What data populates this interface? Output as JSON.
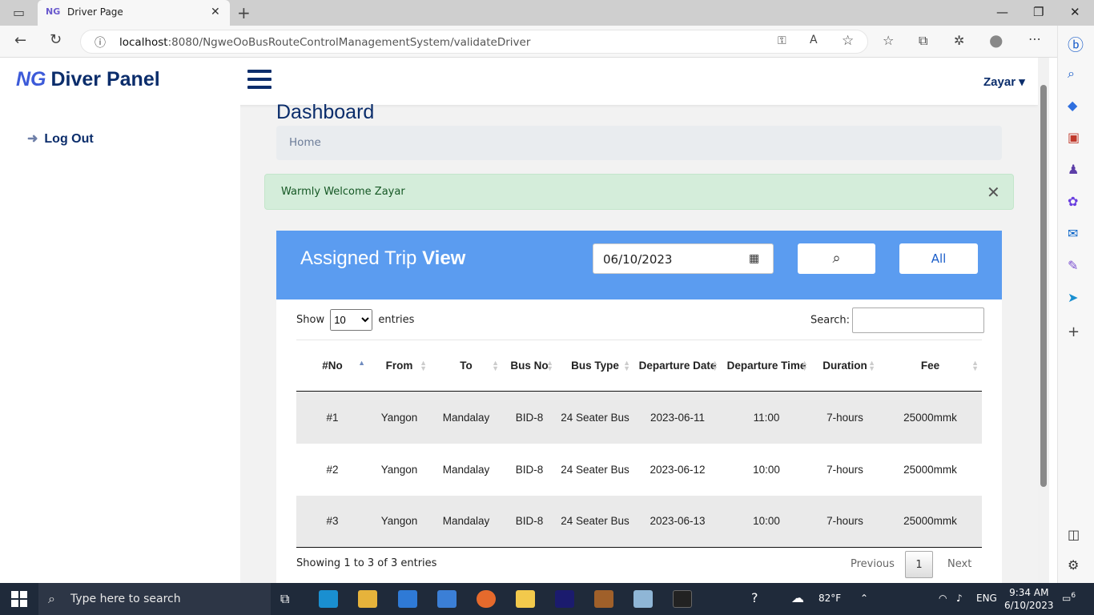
{
  "browser": {
    "tab_title": "Driver Page",
    "url_host": "localhost",
    "url_rest": ":8080/NgweOoBusRouteControlManagementSystem/validateDriver",
    "controls": {
      "minimize": "—",
      "restore": "❐",
      "close": "✕"
    }
  },
  "header": {
    "logo": "NG",
    "brand": "Diver Panel",
    "user": "Zayar ▾"
  },
  "sidebar": {
    "items": [
      {
        "label": "Log Out",
        "icon": "arrow-right-icon"
      }
    ]
  },
  "main": {
    "title": "Dashboard",
    "breadcrumb": "Home",
    "alert": "Warmly Welcome Zayar"
  },
  "card": {
    "title_light": "Assigned Trip ",
    "title_bold": "View",
    "date_value": "06/10/2023",
    "all_label": "All",
    "show_label": "Show",
    "entries_label": "entries",
    "page_length": "10",
    "search_label": "Search:"
  },
  "table": {
    "columns": [
      "#No",
      "From",
      "To",
      "Bus No",
      "Bus Type",
      "Departure Date",
      "Departure Time",
      "Duration",
      "Fee"
    ],
    "rows": [
      [
        "#1",
        "Yangon",
        "Mandalay",
        "BID-8",
        "24 Seater Bus",
        "2023-06-11",
        "11:00",
        "7-hours",
        "25000mmk"
      ],
      [
        "#2",
        "Yangon",
        "Mandalay",
        "BID-8",
        "24 Seater Bus",
        "2023-06-12",
        "10:00",
        "7-hours",
        "25000mmk"
      ],
      [
        "#3",
        "Yangon",
        "Mandalay",
        "BID-8",
        "24 Seater Bus",
        "2023-06-13",
        "10:00",
        "7-hours",
        "25000mmk"
      ]
    ]
  },
  "footer": {
    "info": "Showing 1 to 3 of 3 entries",
    "previous": "Previous",
    "page": "1",
    "next": "Next"
  },
  "taskbar": {
    "search_placeholder": "Type here to search",
    "temperature": "82°F",
    "language": "ENG",
    "time": "9:34 AM",
    "date": "6/10/2023",
    "notifications": "6"
  },
  "colors": {
    "brand": "#0b2d6b",
    "card_header": "#5b9cf0",
    "alert_bg": "#d4edda"
  }
}
